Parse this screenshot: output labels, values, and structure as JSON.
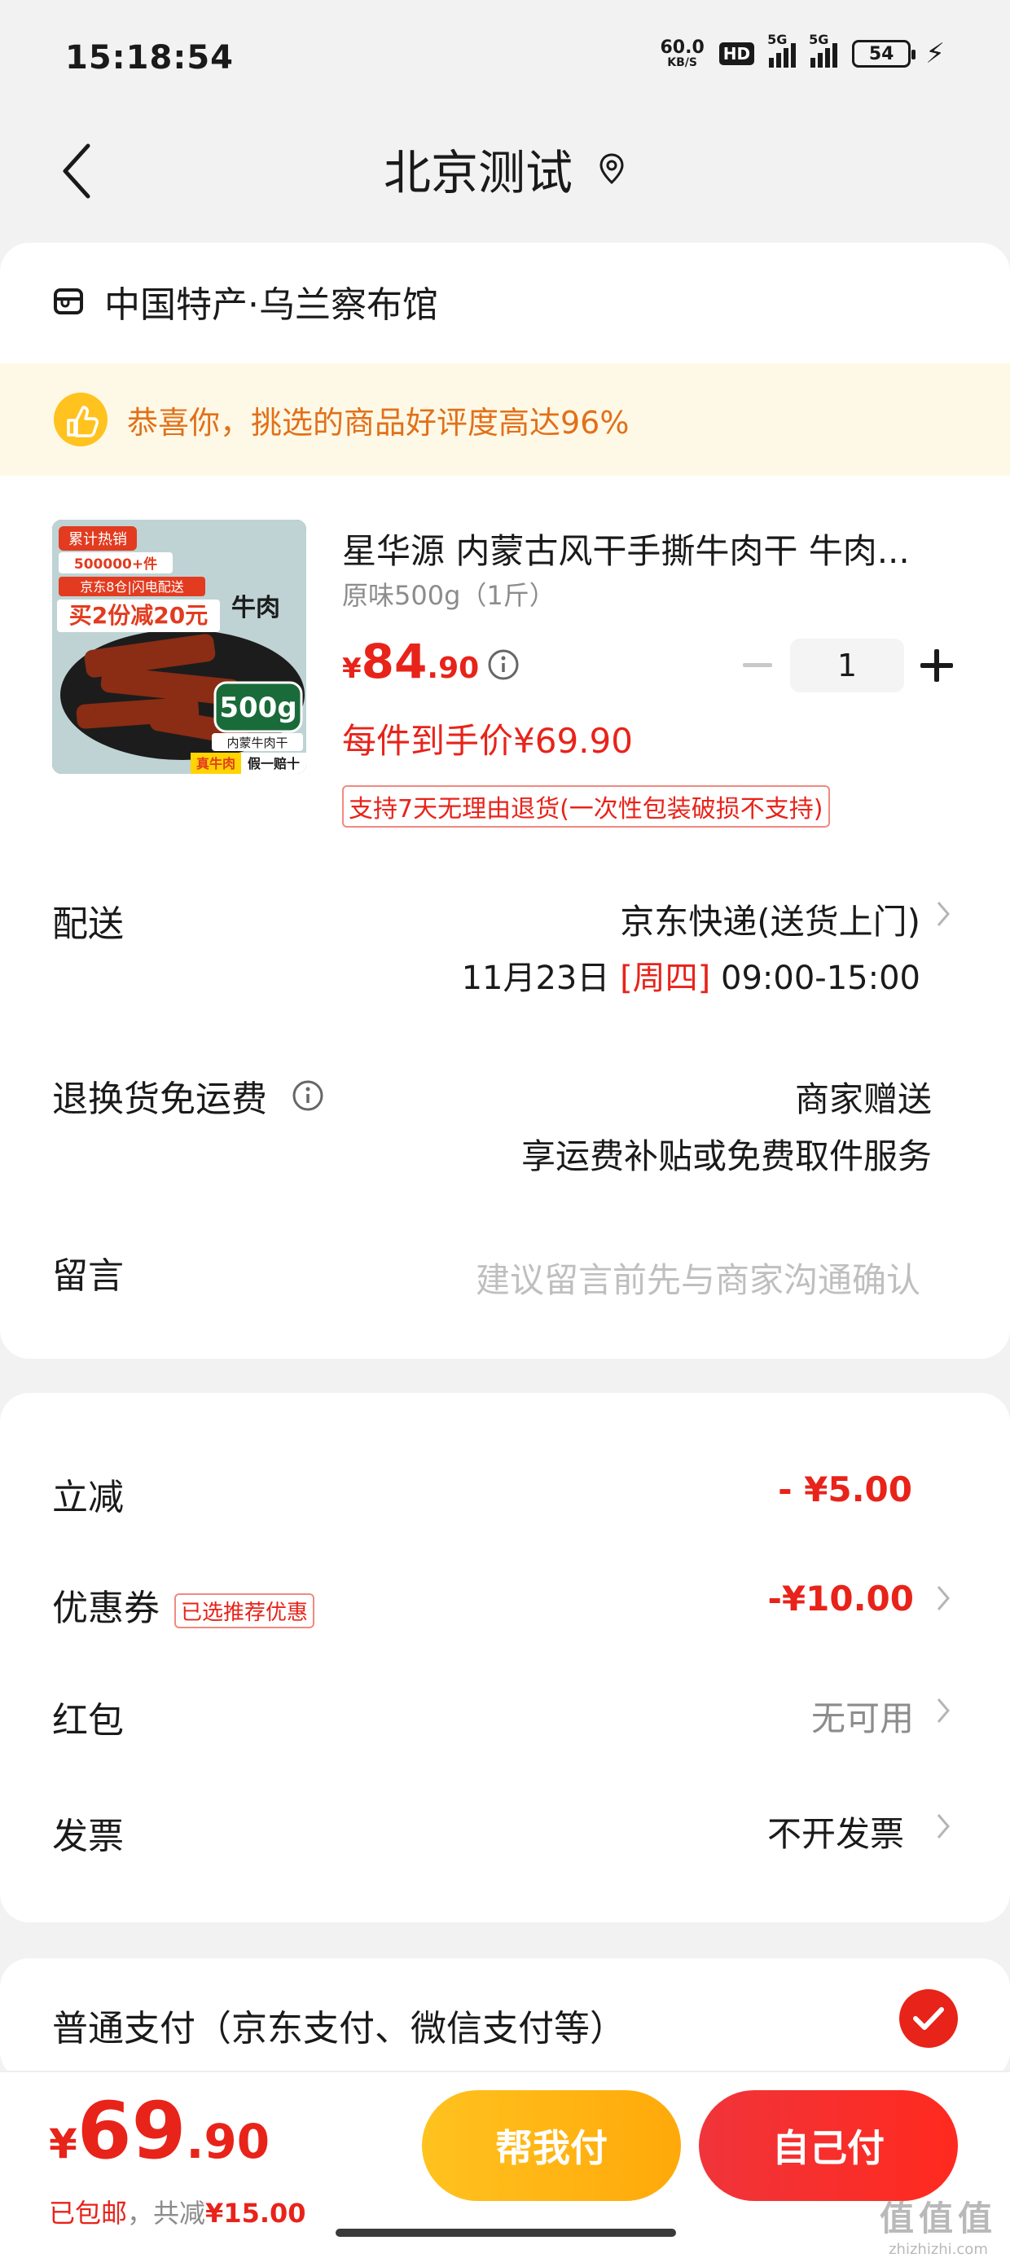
{
  "status_bar": {
    "time": "15:18:54",
    "net_speed": "60.0",
    "net_unit": "KB/S",
    "hd": "HD",
    "sig1": "5G",
    "sig2": "5G",
    "battery": "54"
  },
  "nav": {
    "title": "北京测试"
  },
  "shop": {
    "name": "中国特产·乌兰察布馆"
  },
  "banner": {
    "text": "恭喜你，挑选的商品好评度高达96%"
  },
  "product": {
    "title": "星华源 内蒙古风干手撕牛肉干 牛肉...",
    "spec": "原味500g（1斤）",
    "price_symbol": "¥",
    "price_int": "84",
    "price_dec": ".90",
    "quantity": "1",
    "final_price": "每件到手价¥69.90",
    "return_policy": "支持7天无理由退货(一次性包装破损不支持)",
    "image_text": {
      "hot": "累计热销",
      "sold": "500000+件",
      "jd": "京东8仓|闪电配送",
      "promo": "买2份减20元",
      "name": "牛肉",
      "weight": "500g",
      "sub": "内蒙牛肉干",
      "real": "真牛肉",
      "fake": "假一赔十"
    }
  },
  "delivery": {
    "label": "配送",
    "method": "京东快递(送货上门)",
    "date": "11月23日",
    "weekday": "[周四]",
    "time": "09:00-15:00"
  },
  "return_shipping": {
    "label": "退换货免运费",
    "value": "商家赠送",
    "sub": "享运费补贴或免费取件服务"
  },
  "message": {
    "label": "留言",
    "placeholder": "建议留言前先与商家沟通确认"
  },
  "discounts": {
    "instant_label": "立减",
    "instant_value": "- ¥5.00",
    "coupon_label": "优惠券",
    "coupon_tag": "已选推荐优惠",
    "coupon_value": "-¥10.00",
    "redpacket_label": "红包",
    "redpacket_value": "无可用",
    "invoice_label": "发票",
    "invoice_value": "不开发票"
  },
  "payment": {
    "label": "普通支付（京东支付、微信支付等）"
  },
  "bottom": {
    "total_symbol": "¥",
    "total_int": "69",
    "total_dec": ".90",
    "free_ship": "已包邮",
    "sep": "，",
    "saved_label": "共减",
    "saved_value": "¥15.00",
    "help_pay": "帮我付",
    "self_pay": "自己付"
  },
  "watermark": {
    "logo": "值值值",
    "url": "zhizhizhi.com"
  },
  "colors": {
    "accent": "#e8231a",
    "banner_bg": "#fef9e6",
    "banner_text": "#e2701a",
    "help_btn": "#ffb414",
    "self_btn": "#f0343a"
  }
}
